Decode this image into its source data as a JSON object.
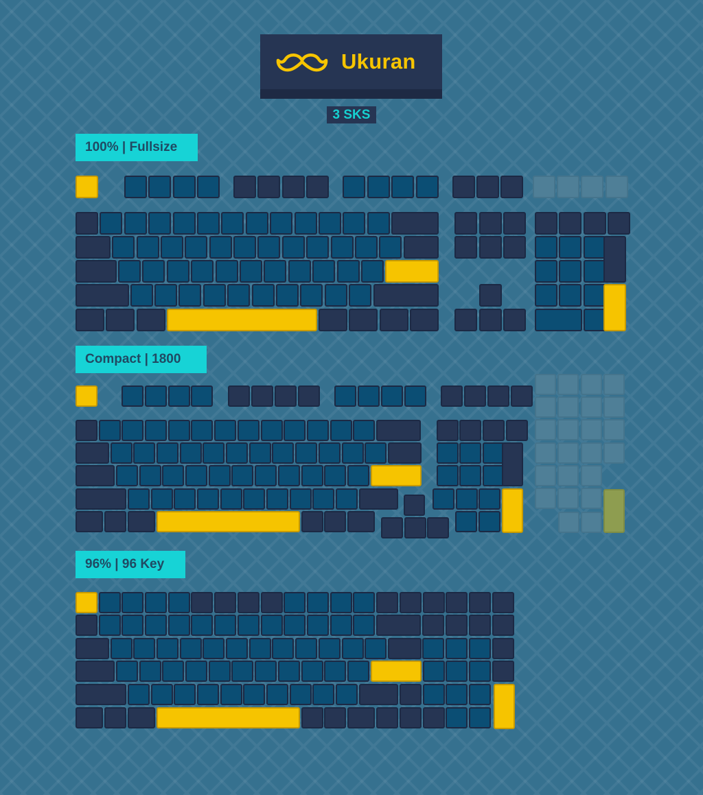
{
  "brand": {
    "name": "Ukuran",
    "subtitle": "3 SKS"
  },
  "sections": [
    {
      "label": "100% | Fullsize"
    },
    {
      "label": "Compact | 1800"
    },
    {
      "label": "96% | 96 Key"
    }
  ],
  "colors": {
    "background": "#36718f",
    "navy_key": "#263553",
    "blue_key": "#0b4e74",
    "yellow_key": "#f6c400",
    "label_bg": "#17d3d6",
    "brand_text": "#f6c400"
  }
}
